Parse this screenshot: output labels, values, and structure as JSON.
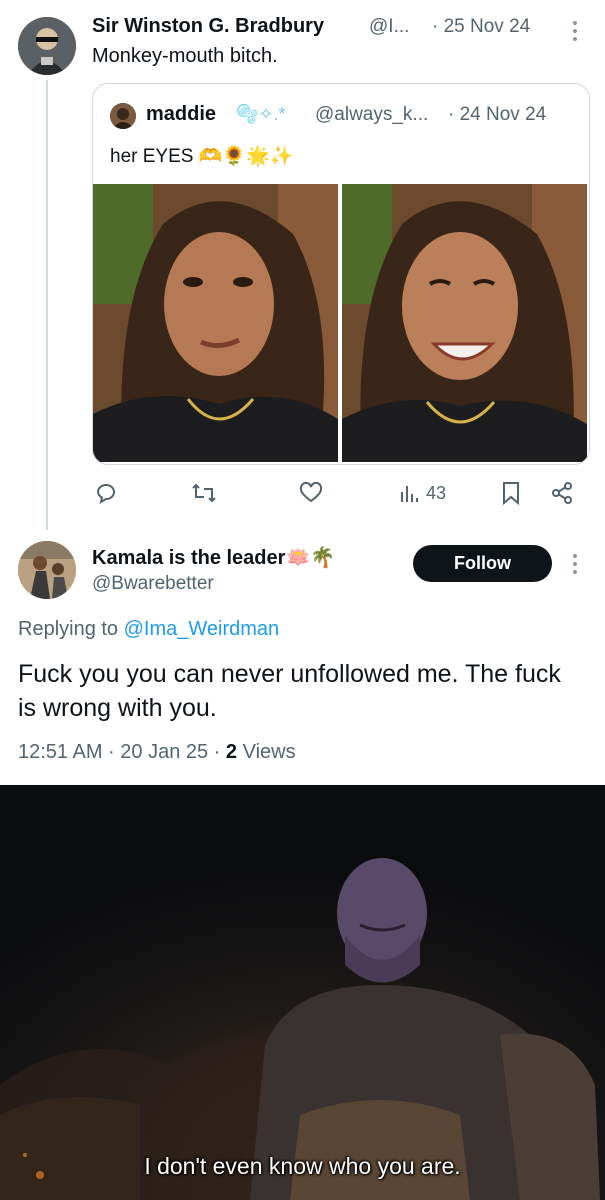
{
  "tweet1": {
    "display_name": "Sir Winston G. Bradbury",
    "handle": "@I...",
    "date": "· 25 Nov 24",
    "text": "Monkey-mouth bitch."
  },
  "quote": {
    "display_name": "maddie",
    "name_emoji": "🫧✧.*",
    "handle": "@always_k...",
    "date": "· 24 Nov 24",
    "text": "her EYES",
    "text_emoji": "🫶🌻🌟✨"
  },
  "actions": {
    "views": "43",
    "icons": [
      "reply-icon",
      "retweet-icon",
      "like-icon",
      "views-icon",
      "bookmark-icon",
      "share-icon"
    ]
  },
  "tweet2": {
    "display_name": "Kamala is the leader",
    "name_emoji": "🪷🌴",
    "handle": "@Bwarebetter",
    "follow_label": "Follow",
    "replying_prefix": "Replying to ",
    "replying_handle": "@Ima_Weirdman",
    "text": "Fuck you you can never unfollowed me. The fuck is wrong with you.",
    "timestamp": "12:51 AM · 20 Jan 25 · ",
    "views_count": "2",
    "views_label": " Views"
  },
  "meme": {
    "caption": "I don't even know who you are."
  },
  "colors": {
    "link": "#1d9bf0",
    "muted": "#536471",
    "follow_bg": "#0f1419"
  }
}
